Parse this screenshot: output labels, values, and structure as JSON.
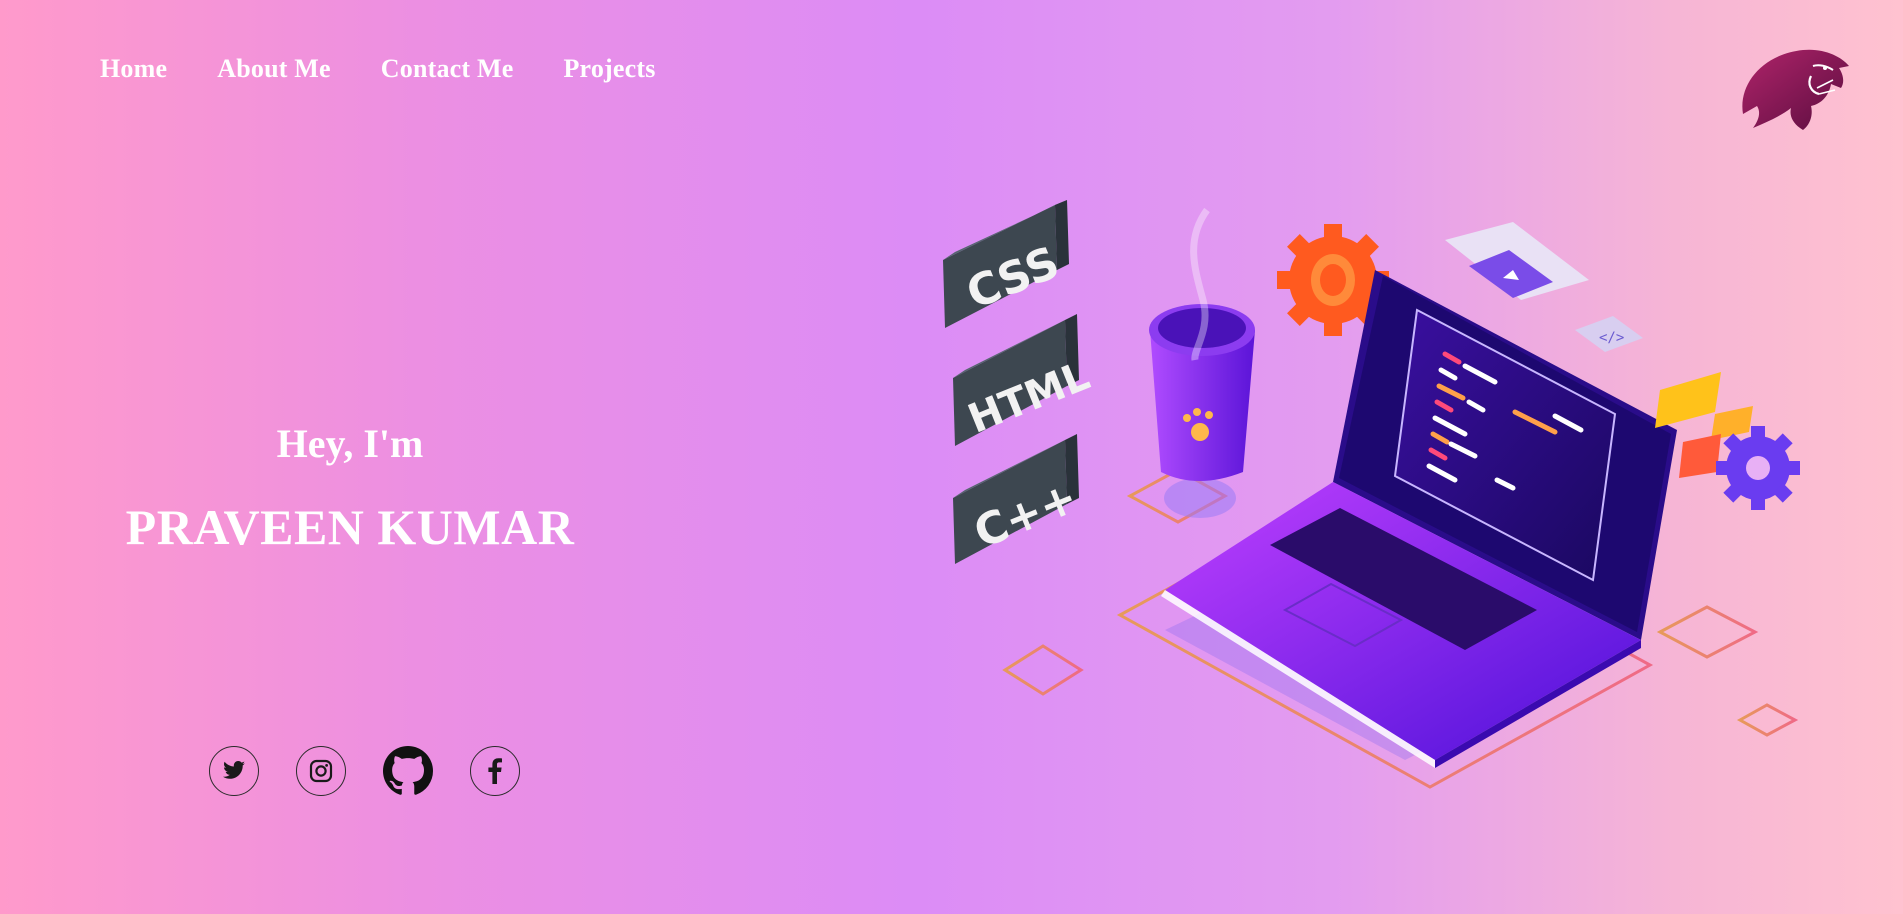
{
  "nav": {
    "items": [
      "Home",
      "About Me",
      "Contact Me",
      "Projects"
    ]
  },
  "logo": {
    "icon": "eagle-logo-icon"
  },
  "hero": {
    "greeting": "Hey, I'm",
    "name": "PRAVEEN KUMAR"
  },
  "social": [
    {
      "icon": "twitter-icon"
    },
    {
      "icon": "instagram-icon"
    },
    {
      "icon": "github-icon"
    },
    {
      "icon": "facebook-icon"
    }
  ],
  "illustration": {
    "tags": [
      "CSS",
      "HTML",
      "C++"
    ],
    "colors": {
      "laptop": "#5b14e0",
      "tag": "#3d4750",
      "gear": "#ff5a1f",
      "outline": "#f07080"
    }
  }
}
